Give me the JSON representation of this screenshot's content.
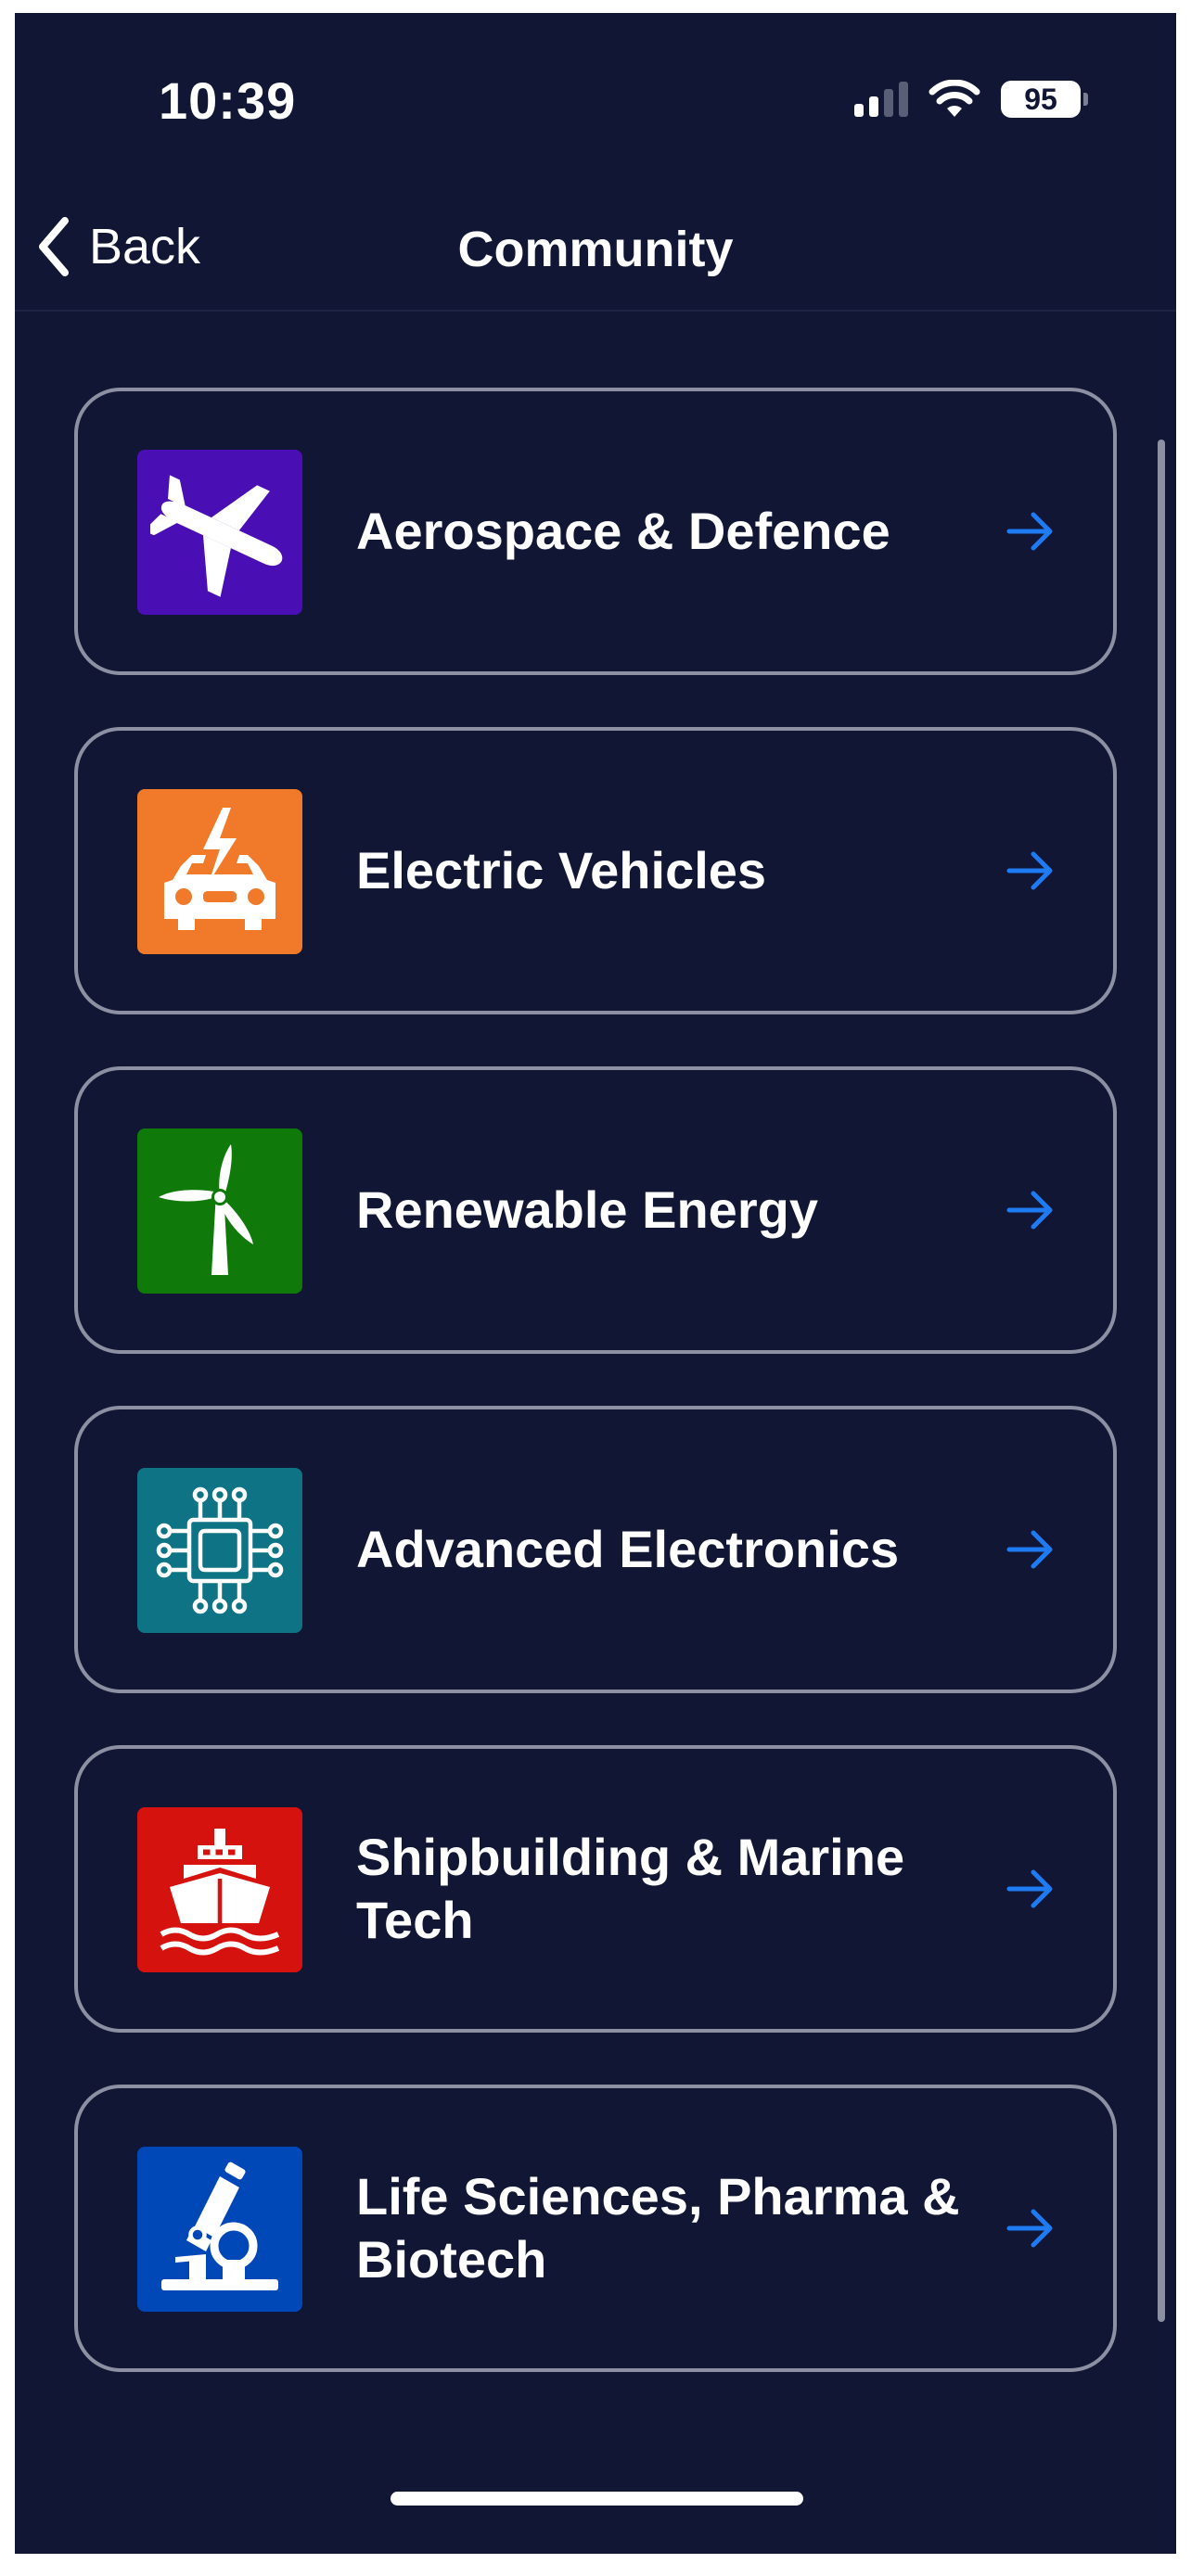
{
  "status_bar": {
    "time": "10:39",
    "battery": "95",
    "signal_bars_active": 2
  },
  "navbar": {
    "back_label": "Back",
    "title": "Community"
  },
  "categories": [
    {
      "label": "Aerospace & Defence",
      "icon": "airplane-icon",
      "color": "#4a0fb4"
    },
    {
      "label": "Electric Vehicles",
      "icon": "electric-car-icon",
      "color": "#f07a2a"
    },
    {
      "label": "Renewable Energy",
      "icon": "wind-turbine-icon",
      "color": "#0f7a0a"
    },
    {
      "label": "Advanced Electronics",
      "icon": "microchip-icon",
      "color": "#0e7384"
    },
    {
      "label": "Shipbuilding & Marine Tech",
      "icon": "ship-icon",
      "color": "#d6120e"
    },
    {
      "label": "Life Sciences, Pharma & Biotech",
      "icon": "microscope-icon",
      "color": "#0047b8"
    }
  ],
  "colors": {
    "background": "#101634",
    "card_border": "#8d90a2",
    "arrow": "#1f7bf2"
  }
}
